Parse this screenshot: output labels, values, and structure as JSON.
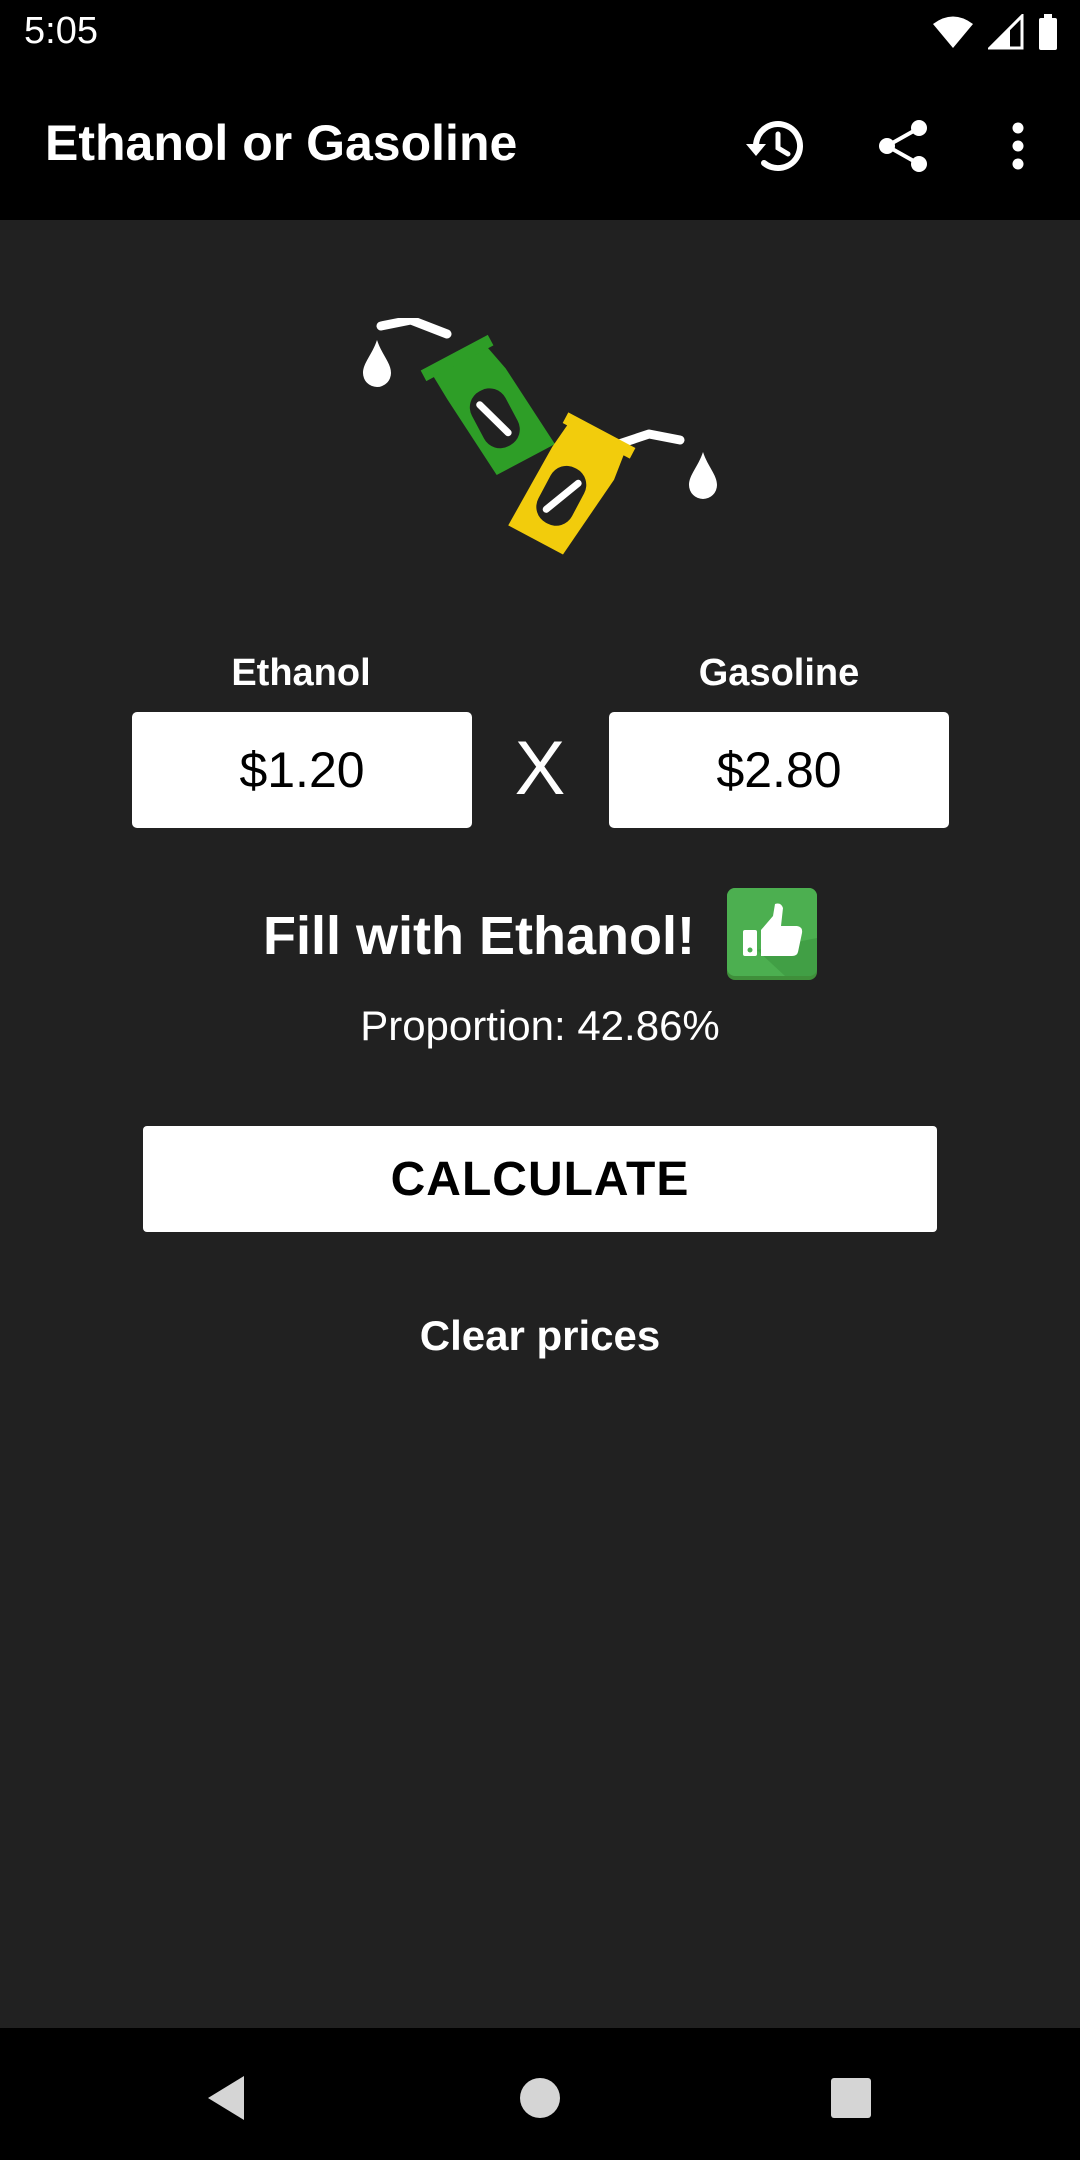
{
  "status_bar": {
    "time": "5:05",
    "icons": [
      "wifi-icon",
      "signal-icon",
      "battery-icon"
    ]
  },
  "app_bar": {
    "title": "Ethanol or Gasoline",
    "actions": [
      "history-icon",
      "share-icon",
      "more-vert-icon"
    ]
  },
  "colors": {
    "background": "#212121",
    "bar": "#000000",
    "ethanol_pump": "#2E9E27",
    "gasoline_pump": "#F2CC0C",
    "thumb_badge": "#4CAF50"
  },
  "form": {
    "ethanol_label": "Ethanol",
    "ethanol_value": "$1.20",
    "gasoline_label": "Gasoline",
    "gasoline_value": "$2.80",
    "separator": "X"
  },
  "result": {
    "message": "Fill with Ethanol!",
    "icon": "thumbs-up-icon",
    "proportion": "Proportion: 42.86%"
  },
  "actions": {
    "calculate_label": "CALCULATE",
    "clear_label": "Clear prices"
  },
  "nav": [
    "back-icon",
    "home-icon",
    "recents-icon"
  ]
}
